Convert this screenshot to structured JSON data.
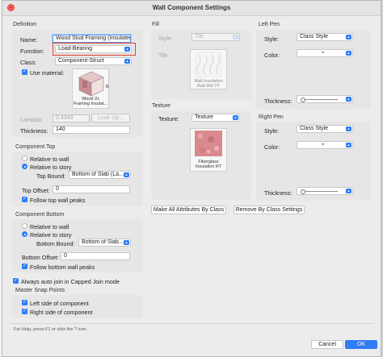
{
  "window": {
    "title": "Wall Component Settings",
    "close_glyph": "×"
  },
  "definition": {
    "section": "Definition",
    "name_label": "Name:",
    "name_value": "Wood Stud Framing (Insulated)",
    "function_label": "Function:",
    "function_value": "Load-Bearing",
    "class_label": "Class:",
    "class_value": "Component-Struct",
    "use_material_label": "Use material:",
    "material_caption": "Wood 2x\nFraming Insulat...",
    "lambda_label": "Lambda:",
    "lambda_value": "0.4343",
    "lookup_label": "Look Up...",
    "thickness_label": "Thickness:",
    "thickness_value": "140"
  },
  "component_top": {
    "section": "Component Top",
    "relative_wall": "Relative to wall",
    "relative_story": "Relative to story",
    "bound_label": "Top Bound:",
    "bound_value": "Bottom of Slab (La...",
    "offset_label": "Top Offset:",
    "offset_value": "0",
    "follow_label": "Follow top wall peaks"
  },
  "component_bottom": {
    "section": "Component Bottom",
    "relative_wall": "Relative to wall",
    "relative_story": "Relative to story",
    "bound_label": "Bottom Bound:",
    "bound_value": "Bottom of Slab...",
    "offset_label": "Bottom Offset:",
    "offset_value": "0",
    "follow_label": "Follow bottom wall peaks"
  },
  "auto_join": "Always auto join in Capped Join mode",
  "snap": {
    "section": "Master Snap Points",
    "left": "Left side of component",
    "right": "Right side of component"
  },
  "fill": {
    "section": "Fill",
    "style_label": "Style:",
    "style_value": "Tile",
    "tile_label": "Tile:",
    "tile_caption": "Wall Insulation\nBatt-Wd TF"
  },
  "texture": {
    "section": "Texture",
    "label": "Texture:",
    "value": "Texture",
    "caption": "Fiberglass\nInsulation RT"
  },
  "left_pen": {
    "section": "Left Pen",
    "style_label": "Style:",
    "style_value": "Class Style",
    "color_label": "Color:",
    "thickness_label": "Thickness:"
  },
  "right_pen": {
    "section": "Right Pen",
    "style_label": "Style:",
    "style_value": "Class Style",
    "color_label": "Color:",
    "thickness_label": "Thickness:"
  },
  "buttons": {
    "make_all": "Make All Attributes By Class",
    "remove": "Remove By Class Settings",
    "cancel": "Cancel",
    "ok": "OK"
  },
  "help_text": "For Help, press F1 or click the ? icon.",
  "colors": {
    "accent": "#2e7cf6",
    "highlight": "#e2412f",
    "swatch_pink": "#d98a8f"
  },
  "icons": [
    "close-icon",
    "popup-arrow-icon",
    "checkbox-check-icon",
    "color-dropper-icon",
    "slider-knob-icon"
  ]
}
